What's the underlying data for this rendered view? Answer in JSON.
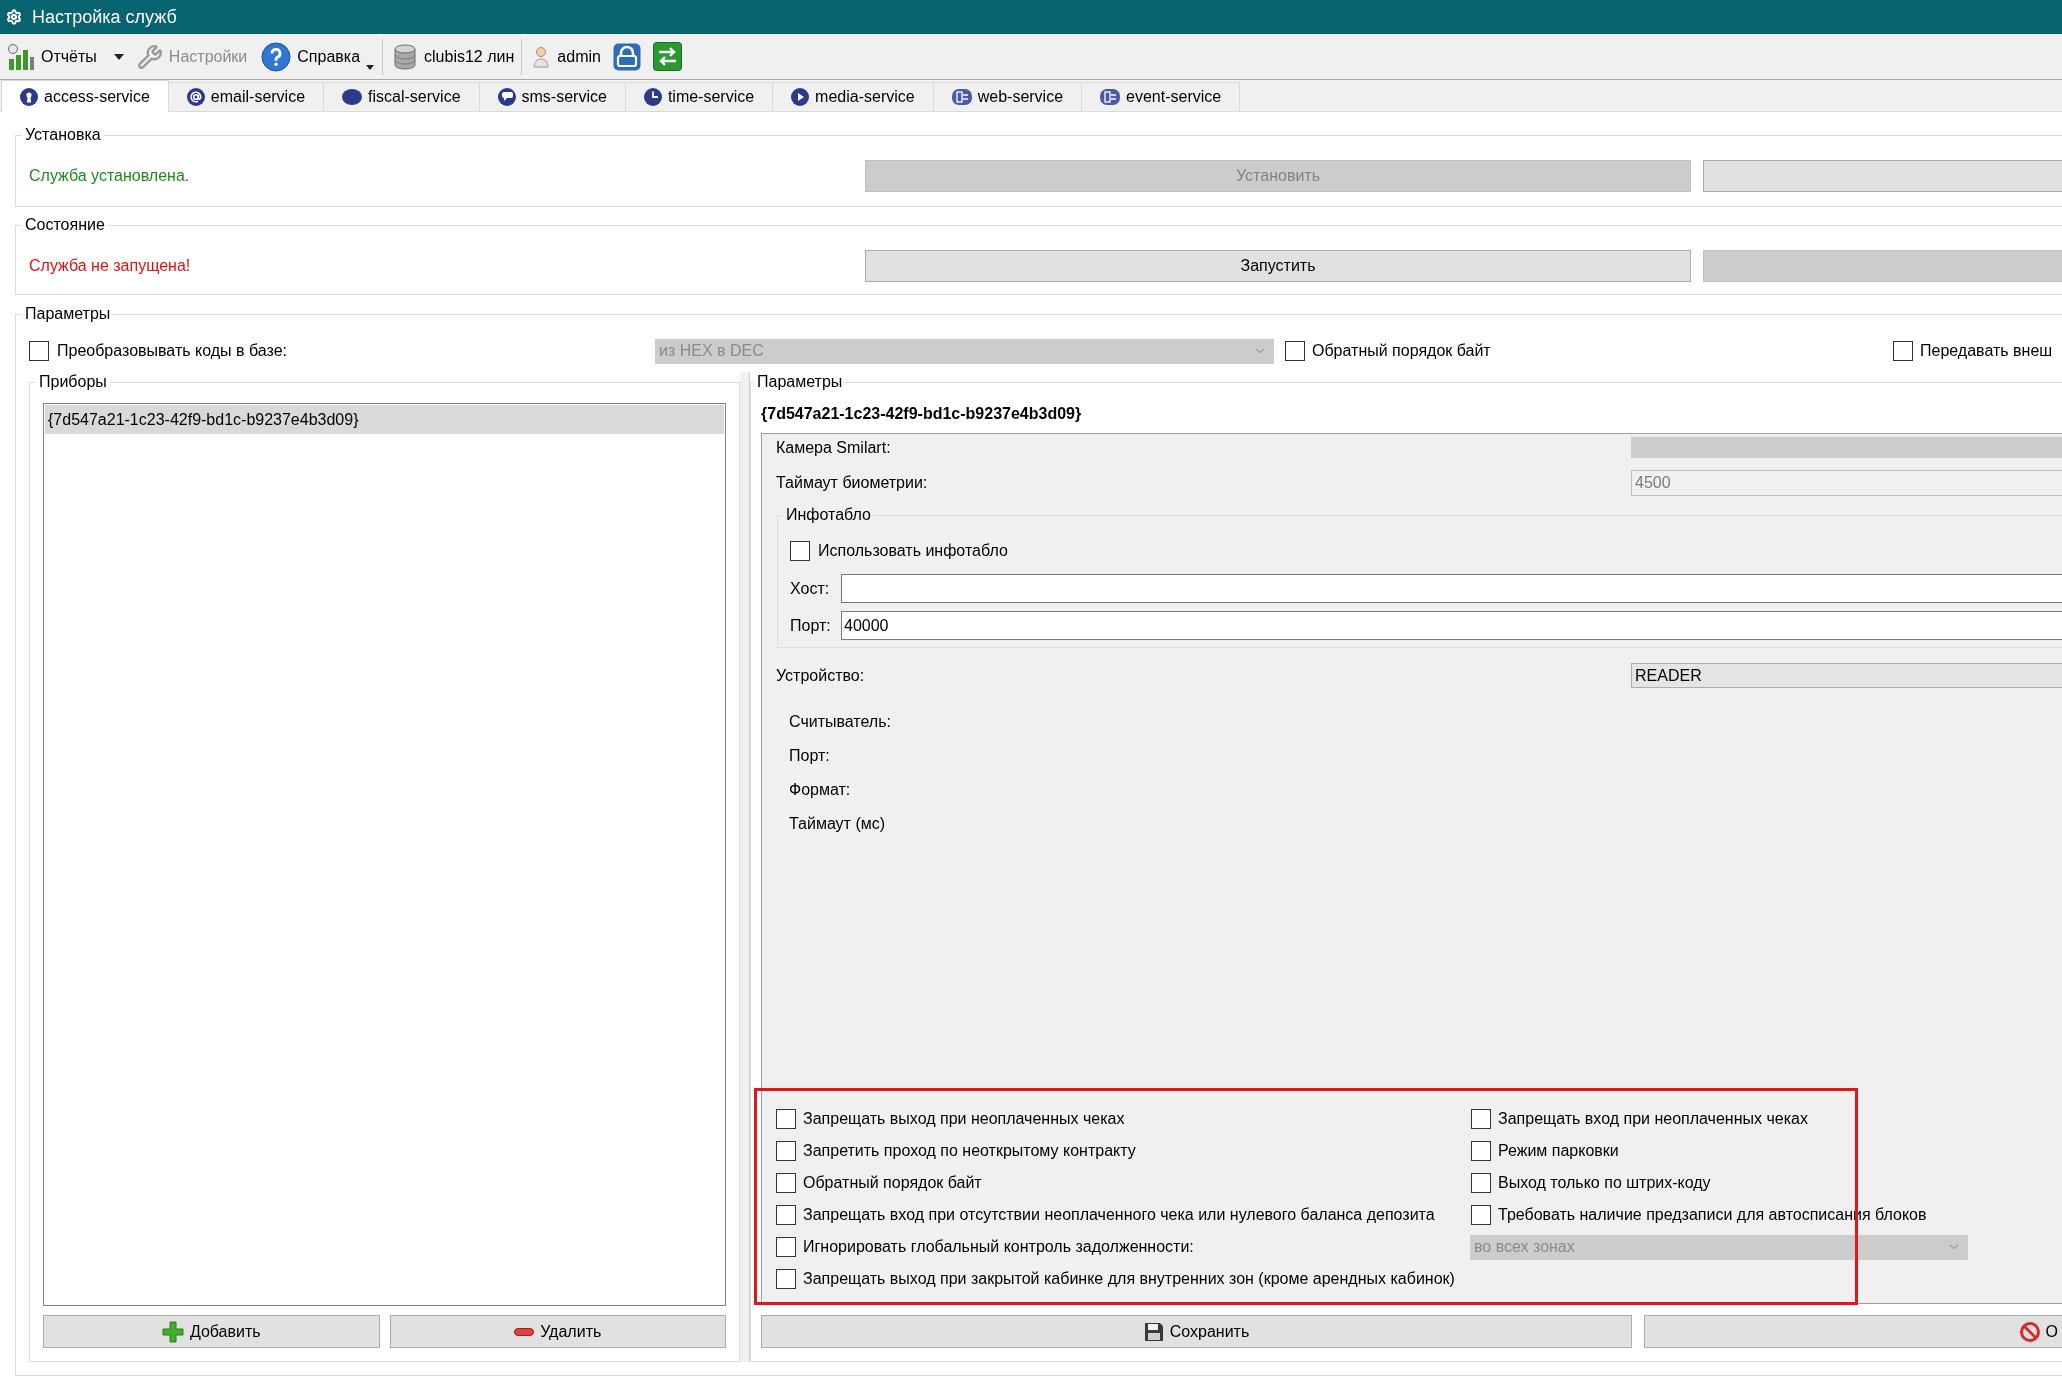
{
  "window": {
    "title": "Настройка служб"
  },
  "toolbar": {
    "groups": [
      [
        {
          "kind": "split_button",
          "label": "Отчёты",
          "disabled": false
        },
        {
          "kind": "button",
          "label": "Настройки",
          "disabled": true
        },
        {
          "kind": "menu_button",
          "label": "Справка",
          "disabled": false
        }
      ],
      [
        {
          "kind": "label",
          "label": "clubis12 лин"
        }
      ],
      [
        {
          "kind": "label",
          "label": "admin"
        },
        {
          "kind": "icon_button"
        },
        {
          "kind": "icon_button"
        }
      ]
    ]
  },
  "tabs": [
    {
      "label": "access-service",
      "selected": true
    },
    {
      "label": "email-service",
      "selected": false
    },
    {
      "label": "fiscal-service",
      "selected": false
    },
    {
      "label": "sms-service",
      "selected": false
    },
    {
      "label": "time-service",
      "selected": false
    },
    {
      "label": "media-service",
      "selected": false
    },
    {
      "label": "web-service",
      "selected": false
    },
    {
      "label": "event-service",
      "selected": false
    }
  ],
  "sections": [
    {
      "title": "Установка",
      "status": "Служба установлена.",
      "ok": true,
      "buttons": [
        {
          "label": "Установить",
          "disabled": true
        },
        {
          "disabled": false
        }
      ]
    },
    {
      "title": "Состояние",
      "status": "Служба не запущена!",
      "ok": false,
      "buttons": [
        {
          "label": "Запустить",
          "disabled": false
        },
        {
          "disabled": true
        }
      ]
    }
  ],
  "parameters": {
    "title": "Параметры",
    "convert_codes": {
      "label": "Преобразовывать коды в базе:",
      "checked": false
    },
    "conversion": {
      "value": "из HEX в DEC",
      "disabled": true
    },
    "reverse_bytes": {
      "label": "Обратный порядок байт",
      "checked": false
    },
    "pass_external": {
      "label": "Передавать внеш",
      "checked": false
    }
  },
  "devices": {
    "title": "Приборы",
    "items": [
      {
        "label": "{7d547a21-1c23-42f9-bd1c-b9237e4b3d09}",
        "selected": true
      }
    ],
    "buttons": [
      {
        "label": "Добавить"
      },
      {
        "label": "Удалить"
      }
    ]
  },
  "device_settings": {
    "title": "Параметры",
    "device_id": "{7d547a21-1c23-42f9-bd1c-b9237e4b3d09}",
    "fields": [
      {
        "kind": "select",
        "label": "Камера Smilart:",
        "disabled": true
      },
      {
        "kind": "text",
        "label": "Таймаут биометрии:",
        "value": "4500",
        "disabled": true
      }
    ],
    "infotablo": {
      "title": "Инфотабло",
      "enabled": {
        "label": "Использовать инфотабло",
        "checked": false
      },
      "host": {
        "label": "Хост:"
      },
      "port": {
        "label": "Порт:",
        "value": "40000"
      }
    },
    "device": {
      "label": "Устройство:",
      "value": "READER"
    },
    "reader": [
      "Считыватель:",
      "Порт:",
      "Формат:",
      "Таймаут (мс)"
    ],
    "options": [
      {
        "kind": "checkbox",
        "label": "Запрещать выход при неоплаченных чеках",
        "checked": false
      },
      {
        "kind": "checkbox",
        "label": "Запрещать вход при неоплаченных чеках",
        "checked": false
      },
      {
        "kind": "checkbox",
        "label": "Запретить проход по неоткрытому контракту",
        "checked": false
      },
      {
        "kind": "checkbox",
        "label": "Режим парковки",
        "checked": false
      },
      {
        "kind": "checkbox",
        "label": "Обратный порядок байт",
        "checked": false
      },
      {
        "kind": "checkbox",
        "label": "Выход только по штрих-коду",
        "checked": false
      },
      {
        "kind": "checkbox",
        "label": "Запрещать вход при отсутствии неоплаченного чека или нулевого баланса депозита",
        "checked": false
      },
      {
        "kind": "checkbox",
        "label": "Требовать наличие предзаписи для автосписания блоков",
        "checked": false
      },
      {
        "kind": "checkbox",
        "label": "Игнорировать глобальный контроль задолженности:",
        "checked": false
      },
      {
        "kind": "select",
        "value": "во всех зонах",
        "disabled": true
      },
      {
        "kind": "checkbox",
        "label": "Запрещать выход при закрытой кабинке для внутренних зон (кроме арендных кабинок)",
        "checked": false
      }
    ],
    "buttons": [
      {
        "label": "Сохранить"
      },
      {
        "label": "О"
      }
    ]
  }
}
